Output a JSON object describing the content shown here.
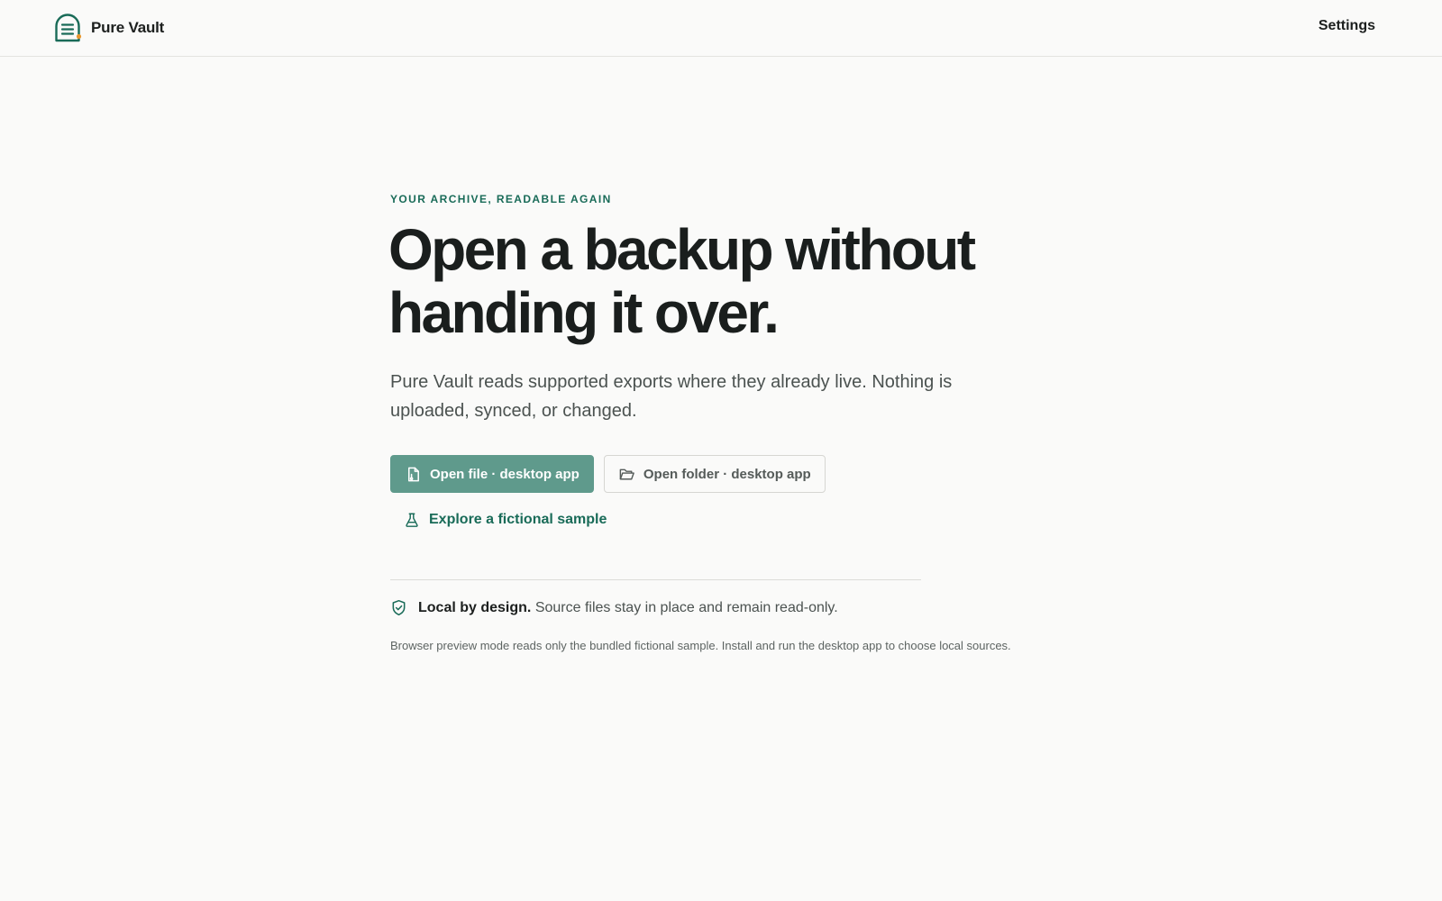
{
  "header": {
    "app_name": "Pure Vault",
    "settings_label": "Settings",
    "logo_icon": "document-vault-logo-icon"
  },
  "hero": {
    "eyebrow": "YOUR ARCHIVE, READABLE AGAIN",
    "headline_line1": "Open a backup without",
    "headline_line2": "handing it over.",
    "lede": "Pure Vault reads supported exports where they already live. Nothing is uploaded, synced, or changed."
  },
  "actions": {
    "open_file_label": "Open file · desktop app",
    "open_file_icon": "file-icon",
    "open_folder_label": "Open folder · desktop app",
    "open_folder_icon": "folder-open-icon",
    "sample_label": "Explore a fictional sample",
    "sample_icon": "flask-icon"
  },
  "notice": {
    "icon": "shield-check-icon",
    "strong": "Local by design.",
    "text": "Source files stay in place and remain read-only.",
    "footnote": "Browser preview mode reads only the bundled fictional sample. Install and run the desktop app to choose local sources."
  },
  "colors": {
    "accent": "#196b58",
    "primary_button": "#5f9a8c",
    "logo_dot": "#e8962e",
    "background": "#fafaf9"
  }
}
